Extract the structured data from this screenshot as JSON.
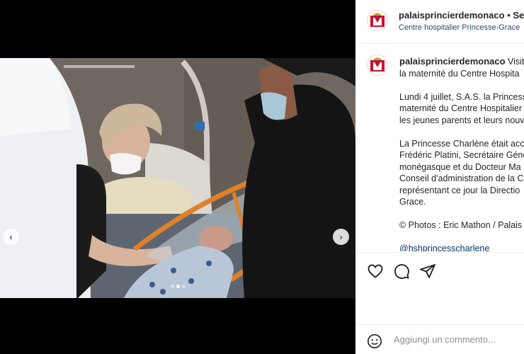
{
  "post": {
    "username": "palaisprincierdemonaco",
    "separator": "•",
    "follow_label": "Seg",
    "location": "Centre hospitalier Princesse-Grace"
  },
  "media": {
    "prev_icon": "chevron-left-icon",
    "next_icon": "chevron-right-icon",
    "slide_count": 3,
    "active_slide": 2
  },
  "caption": {
    "username": "palaisprincierdemonaco",
    "line1_rest": "Visite",
    "line2": "la maternité du Centre Hospita",
    "p1": [
      "Lundi 4 juillet, S.A.S. la Princess",
      "maternité du Centre Hospitalier",
      "les jeunes parents et leurs nouv"
    ],
    "p2": [
      "La Princesse Charlène était acc",
      "Frédéric Platini, Secrétaire Géné",
      "monégasque et du Docteur Ma",
      "Conseil d'administration de la C",
      "représentant ce jour la Directio",
      "Grace."
    ],
    "p3": "© Photos : Eric Mathon / Palais",
    "mention": "@hshprincesscharlene"
  },
  "actions": {
    "like_icon": "heart-icon",
    "comment_icon": "comment-icon",
    "share_icon": "share-icon"
  },
  "comment": {
    "emoji_icon": "emoji-icon",
    "placeholder": "Aggiungi un commento..."
  },
  "colors": {
    "link": "#2f4a6d",
    "mention": "#00376b",
    "border": "#efefef",
    "media_bg": "#000000"
  }
}
